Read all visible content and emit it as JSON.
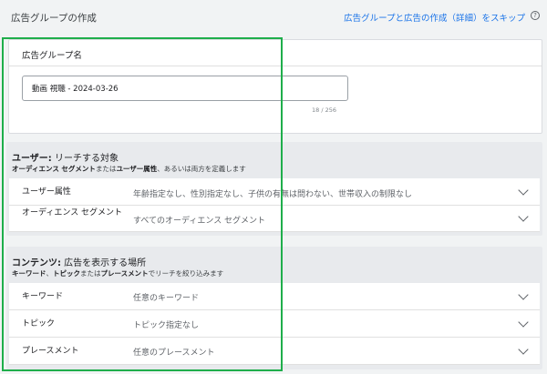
{
  "header": {
    "title": "広告グループの作成",
    "skip_link": "広告グループと広告の作成（詳細）をスキップ",
    "help_icon": "?"
  },
  "adgroup": {
    "title": "広告グループ名",
    "name_value": "動画 視聴 - 2024-03-26",
    "char_count": "18 / 256"
  },
  "users_section": {
    "title_bold": "ユーザー:",
    "title_rest": " リーチする対象",
    "desc_part1": "オーディエンス セグメント",
    "desc_part2": "または",
    "desc_part3": "ユーザー属性",
    "desc_part4": "、あるいは両方を定義します",
    "rows": [
      {
        "label": "ユーザー属性",
        "value": "年齢指定なし、性別指定なし、子供の有無は問わない、世帯収入の制限なし"
      },
      {
        "label": "オーディエンス セグメント",
        "value": "すべてのオーディエンス セグメント"
      }
    ]
  },
  "content_section": {
    "title_bold": "コンテンツ:",
    "title_rest": " 広告を表示する場所",
    "desc_part1": "キーワード",
    "desc_part2": "、",
    "desc_part3": "トピック",
    "desc_part4": "または",
    "desc_part5": "プレースメント",
    "desc_part6": "でリーチを絞り込みます",
    "rows": [
      {
        "label": "キーワード",
        "value": "任意のキーワード"
      },
      {
        "label": "トピック",
        "value": "トピック指定なし"
      },
      {
        "label": "プレースメント",
        "value": "任意のプレースメント"
      }
    ]
  },
  "colors": {
    "highlight": "#1fae4b",
    "link": "#1a73e8",
    "section_bg": "#e8eaed"
  }
}
